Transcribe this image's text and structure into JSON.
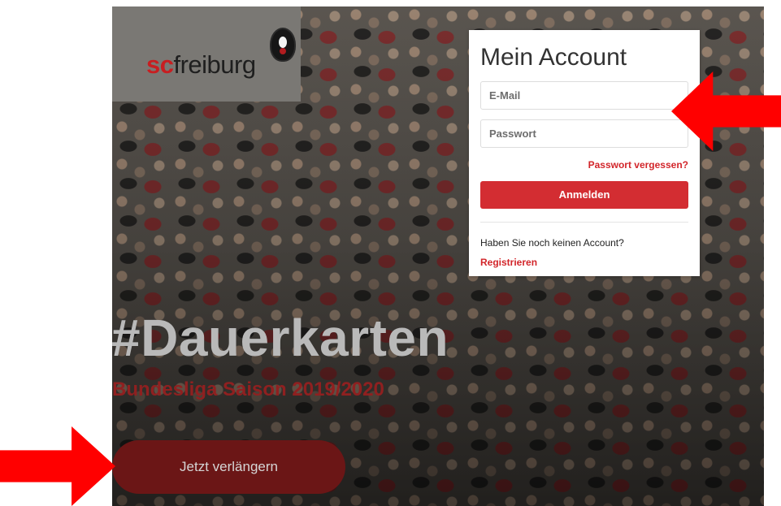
{
  "brand": {
    "logo_sc": "sc",
    "logo_rest": "freiburg"
  },
  "hero": {
    "headline": "#Dauerkarten",
    "subheadline": "Bundesliga Saison 2019/2020",
    "cta_label": "Jetzt verlängern"
  },
  "login": {
    "title": "Mein Account",
    "email_placeholder": "E-Mail",
    "password_placeholder": "Passwort",
    "forgot_password": "Passwort vergessen?",
    "submit_label": "Anmelden",
    "no_account_text": "Haben Sie noch keinen Account?",
    "register_link": "Registrieren"
  },
  "colors": {
    "accent_red": "#d32d32",
    "dark_red": "#6b1616",
    "annotation_red": "#ff0000"
  },
  "icons": {
    "crest": "freiburg-crest-icon",
    "arrow_left": "red-arrow-left-icon",
    "arrow_right": "red-arrow-right-icon"
  }
}
